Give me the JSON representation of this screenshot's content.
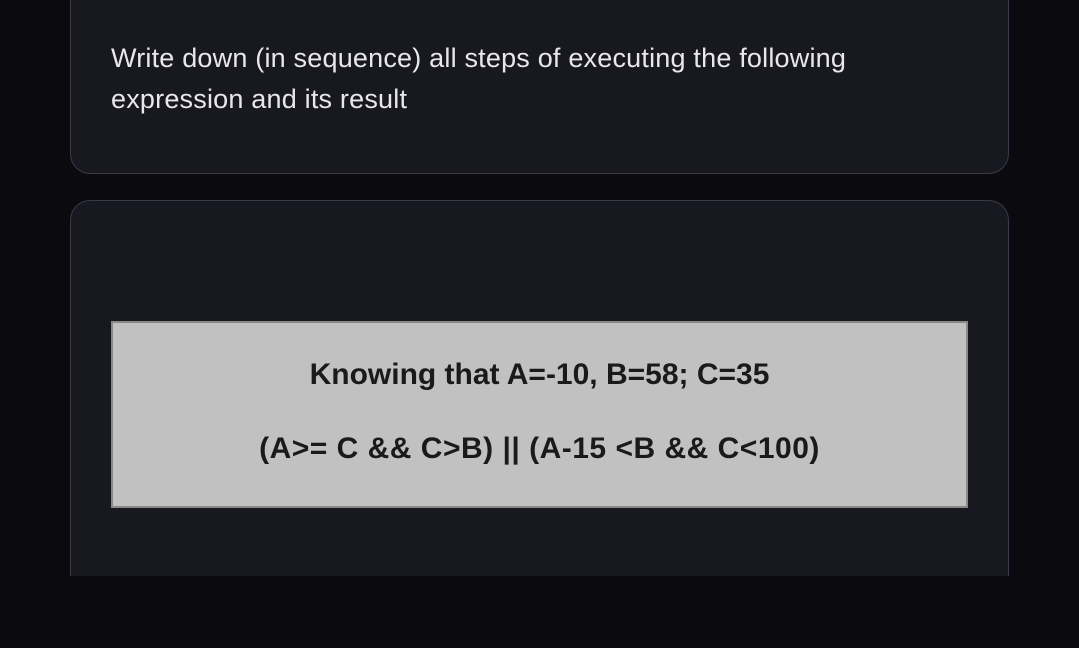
{
  "prompt": {
    "text": "Write down (in sequence) all steps of executing the following expression and its result"
  },
  "problem": {
    "given": "Knowing that  A=-10, B=58; C=35",
    "expression": "(A>= C && C>B)  ||  (A-15 <B &&  C<100)"
  }
}
